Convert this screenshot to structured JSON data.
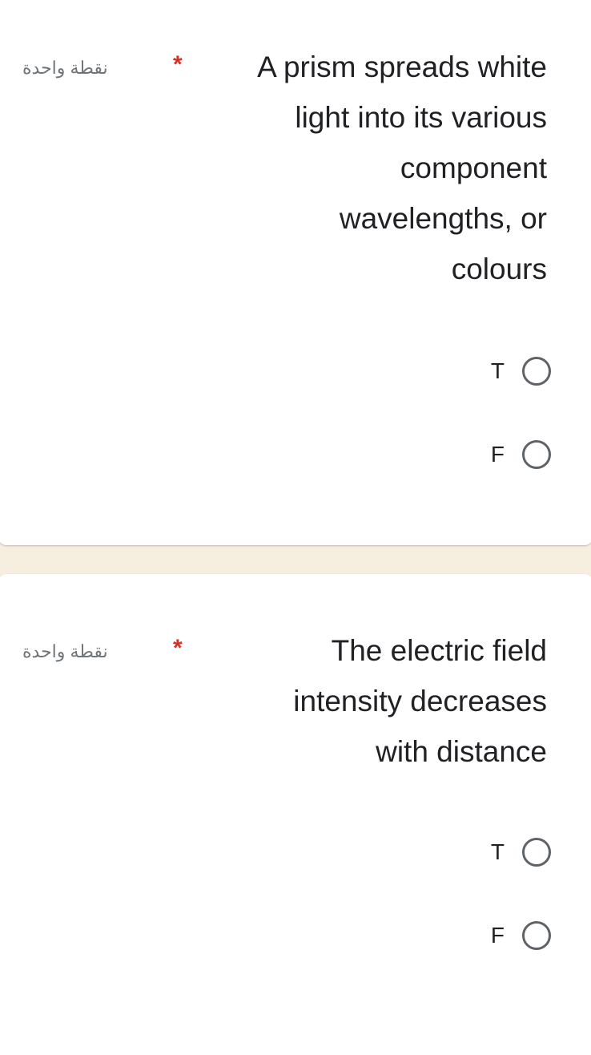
{
  "questions": [
    {
      "points_label": "نقطة واحدة",
      "required_marker": "*",
      "text_lines": [
        "A prism spreads white",
        "light into its various",
        "component",
        "wavelengths, or",
        "colours"
      ],
      "options": [
        {
          "label": "T",
          "selected": false
        },
        {
          "label": "F",
          "selected": false
        }
      ]
    },
    {
      "points_label": "نقطة واحدة",
      "required_marker": "*",
      "text_lines": [
        "The electric field",
        "intensity decreases",
        "with distance"
      ],
      "options": [
        {
          "label": "T",
          "selected": false
        },
        {
          "label": "F",
          "selected": false
        }
      ]
    }
  ],
  "colors": {
    "background": "#f6eedf",
    "required": "#d93025",
    "radio_border": "#5f6368"
  }
}
